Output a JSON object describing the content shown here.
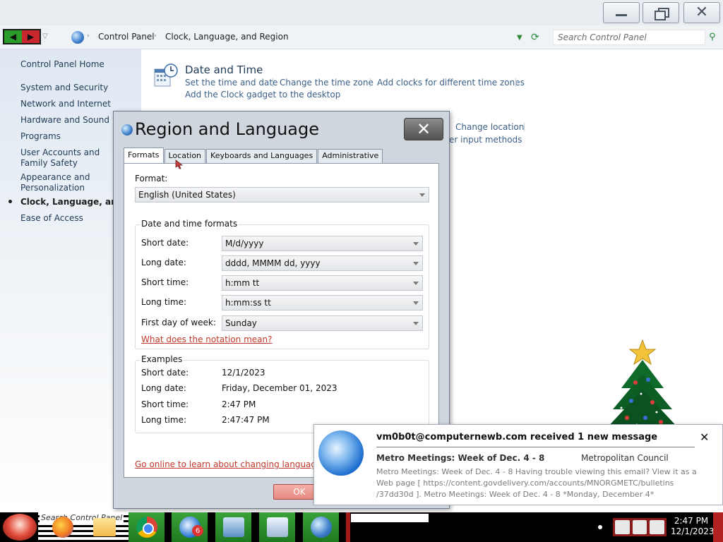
{
  "window": {
    "controls": {
      "minimize": "minimize",
      "maximize": "restore",
      "close": "close"
    }
  },
  "address": {
    "crumbs": [
      "Control Panel",
      "Clock, Language, and Region"
    ],
    "search_placeholder": "Search Control Panel"
  },
  "sidebar": {
    "home": "Control Panel Home",
    "items": [
      "System and Security",
      "Network and Internet",
      "Hardware and Sound",
      "Programs",
      "User Accounts and Family Safety",
      "Appearance and Personalization",
      "Clock, Language, and Region",
      "Ease of Access"
    ],
    "current_index": 6
  },
  "content": {
    "date_time": {
      "title": "Date and Time",
      "links": [
        "Set the time and date",
        "Change the time zone",
        "Add clocks for different time zones",
        "Add the Clock gadget to the desktop"
      ]
    },
    "region_peek": {
      "title": "Region and Language",
      "links": [
        "Change location",
        "er input methods"
      ]
    }
  },
  "dialog": {
    "title": "Region and Language",
    "tabs": [
      "Formats",
      "Location",
      "Keyboards and Languages",
      "Administrative"
    ],
    "active_tab": 0,
    "format_label": "Format:",
    "format_value": "English (United States)",
    "dt_group_title": "Date and time formats",
    "dt_rows": [
      {
        "label": "Short date:",
        "value": "M/d/yyyy"
      },
      {
        "label": "Long date:",
        "value": "dddd, MMMM dd, yyyy"
      },
      {
        "label": "Short time:",
        "value": "h:mm tt"
      },
      {
        "label": "Long time:",
        "value": "h:mm:ss tt"
      },
      {
        "label": "First day of week:",
        "value": "Sunday"
      }
    ],
    "notation_link": "What does the notation mean?",
    "examples_title": "Examples",
    "examples": [
      {
        "label": "Short date:",
        "value": "12/1/2023"
      },
      {
        "label": "Long date:",
        "value": "Friday, December 01, 2023"
      },
      {
        "label": "Short time:",
        "value": "2:47 PM"
      },
      {
        "label": "Long time:",
        "value": "2:47:47 PM"
      }
    ],
    "online_link": "Go online to learn about changing languages and",
    "ok_label": "OK"
  },
  "notification": {
    "header": "vm0b0t@computernewb.com received 1 new message",
    "subject": "Metro Meetings: Week of Dec. 4 - 8",
    "from": "Metropolitan Council",
    "body": "Metro Meetings: Week of Dec. 4 - 8  Having trouble viewing this email? View it as a Web page [ https://content.govdelivery.com/accounts/MNORGMETC/bulletins /37dd30d ].   Metro Meetings: Week of Dec. 4 - 8 *Monday, December 4*"
  },
  "taskbar": {
    "search_text": "Search  Control Panel",
    "thunderbird_badge": "6",
    "time": "2:47 PM",
    "date": "12/1/2023"
  }
}
